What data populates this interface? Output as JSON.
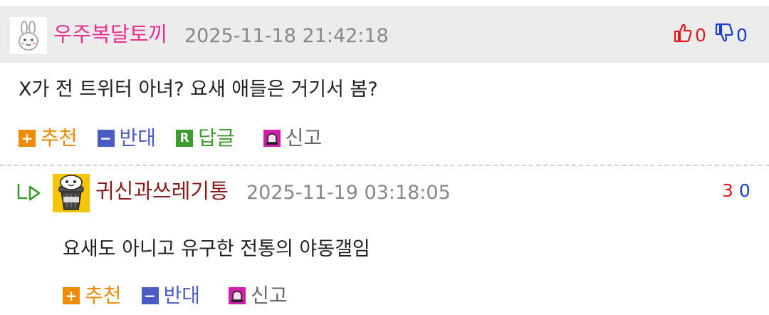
{
  "comment": {
    "author": "우주복달토끼",
    "date": "2025-11-18 21:42:18",
    "likes": "0",
    "dislikes": "0",
    "text": "X가 전 트위터 아녀? 요새 애들은 거기서 봄?",
    "actions": {
      "recommend": "추천",
      "oppose": "반대",
      "reply": "답글",
      "report": "신고"
    }
  },
  "reply": {
    "author": "귀신과쓰레기통",
    "date": "2025-11-19 03:18:05",
    "likes": "3",
    "dislikes": "0",
    "text": "요새도 아니고 유구한 전통의 야동갤임",
    "actions": {
      "recommend": "추천",
      "oppose": "반대",
      "report": "신고"
    }
  },
  "colors": {
    "author": "#e8308f",
    "reply_author": "#8b1a1a",
    "recommend": "#f08a00",
    "oppose": "#4a5bc4",
    "reply": "#3f9a2f",
    "report": "#d11fa8",
    "like": "#e11b1b",
    "dislike": "#1a3fcf"
  }
}
